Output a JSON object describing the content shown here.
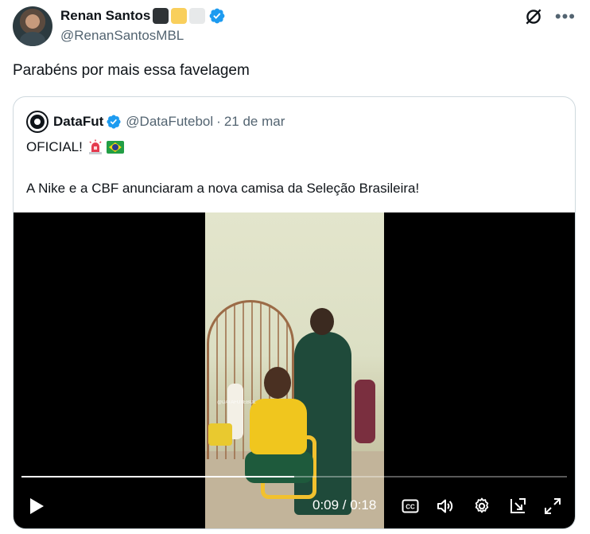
{
  "author": {
    "display_name": "Renan Santos",
    "handle": "@RenanSantosMBL",
    "flag_squares": [
      "#2f3336",
      "#f9cf5c",
      "#e7e9ea"
    ]
  },
  "tweet": {
    "text": "Parabéns por mais essa favelagem"
  },
  "quoted": {
    "display_name": "DataFut",
    "handle": "@DataFutebol",
    "separator": "·",
    "date": "21 de mar",
    "line1": "OFICIAL!",
    "line2": "A Nike e a CBF anunciaram a nova camisa da Seleção Brasileira!",
    "video": {
      "current_time": "0:09",
      "duration": "0:18",
      "time_display": "0:09 / 0:18",
      "progress": 0.5,
      "watermark": "@DATAFUTEBOL"
    }
  },
  "icons": {
    "verified": "verified-badge-icon",
    "grok": "grok-icon",
    "more": "more-icon",
    "play": "play-icon",
    "captions": "captions-icon",
    "volume": "volume-icon",
    "settings": "gear-icon",
    "pip": "picture-in-picture-icon",
    "fullscreen": "fullscreen-icon"
  },
  "colors": {
    "accent": "#1d9bf0",
    "text": "#0f1419",
    "secondary": "#536471",
    "border": "#cfd9de"
  }
}
